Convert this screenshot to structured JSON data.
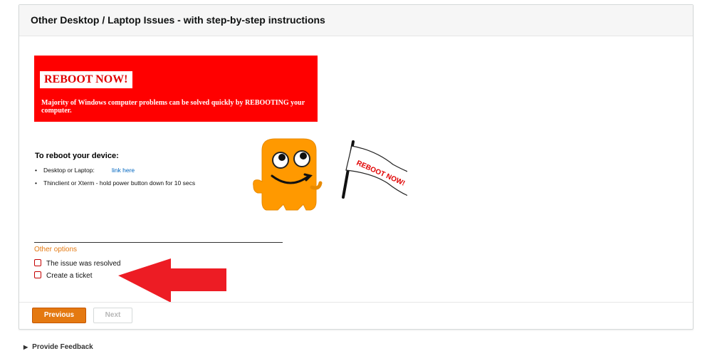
{
  "panel": {
    "title": "Other Desktop / Laptop Issues - with step-by-step instructions"
  },
  "banner": {
    "badge": "REBOOT NOW!",
    "text": "Majority of Windows computer problems can be solved quickly by REBOOTING your computer."
  },
  "instructions": {
    "heading": "To reboot your device:",
    "steps": [
      {
        "text": "Desktop or Laptop:",
        "link": "link here"
      },
      {
        "text": "Thinclient or Xterm - hold power button down for 10 secs"
      }
    ]
  },
  "mascot": {
    "flag_text": "REBOOT NOW!"
  },
  "options": {
    "label": "Other options",
    "items": [
      "The issue was resolved",
      "Create a ticket"
    ]
  },
  "buttons": {
    "previous": "Previous",
    "next": "Next"
  },
  "feedback": {
    "label": "Provide Feedback"
  },
  "colors": {
    "banner": "#ff0000",
    "accent": "#e47911",
    "link": "#0066c0",
    "arrow": "#ed1c24",
    "mascot": "#ff9900"
  }
}
